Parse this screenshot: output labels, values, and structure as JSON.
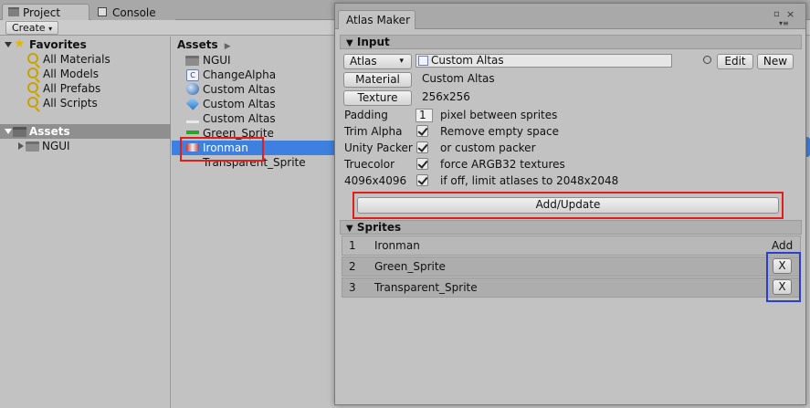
{
  "project_window": {
    "tabs": [
      {
        "label": "Project",
        "active": true
      },
      {
        "label": "Console",
        "active": false
      }
    ],
    "create_label": "Create",
    "favorites": {
      "title": "Favorites",
      "items": [
        "All Materials",
        "All Models",
        "All Prefabs",
        "All Scripts"
      ]
    },
    "assets_root": {
      "title": "Assets",
      "children": [
        "NGUI"
      ]
    },
    "breadcrumb": "Assets",
    "asset_list": [
      {
        "name": "NGUI",
        "icon": "folder-icon"
      },
      {
        "name": "ChangeAlpha",
        "icon": "script-icon"
      },
      {
        "name": "Custom Altas",
        "icon": "material-icon"
      },
      {
        "name": "Custom Altas",
        "icon": "prefab-icon"
      },
      {
        "name": "Custom Altas",
        "icon": "texture-icon"
      },
      {
        "name": "Green_Sprite",
        "icon": "texture-icon"
      },
      {
        "name": "Ironman",
        "icon": "texture-icon",
        "selected": true
      },
      {
        "name": "Transparent_Sprite",
        "icon": "texture-icon"
      }
    ]
  },
  "atlas_maker": {
    "title": "Atlas Maker",
    "input_section": "Input",
    "atlas_dropdown": "Atlas",
    "atlas_field": "Custom Altas",
    "edit_label": "Edit",
    "new_label": "New",
    "material_label": "Material",
    "material_value": "Custom Altas",
    "texture_label": "Texture",
    "texture_value": "256x256",
    "padding_label": "Padding",
    "padding_value": "1",
    "padding_desc": "pixel between sprites",
    "options": [
      {
        "label": "Trim Alpha",
        "checked": true,
        "desc": "Remove empty space"
      },
      {
        "label": "Unity Packer",
        "checked": true,
        "desc": "or custom packer"
      },
      {
        "label": "Truecolor",
        "checked": true,
        "desc": "force ARGB32 textures"
      },
      {
        "label": "4096x4096",
        "checked": true,
        "desc": "if off, limit atlases to 2048x2048"
      }
    ],
    "add_update_label": "Add/Update",
    "sprites_section": "Sprites",
    "sprites": [
      {
        "index": "1",
        "name": "Ironman",
        "action": "Add"
      },
      {
        "index": "2",
        "name": "Green_Sprite",
        "action": "X"
      },
      {
        "index": "3",
        "name": "Transparent_Sprite",
        "action": "X"
      }
    ]
  },
  "colors": {
    "selection_blue": "#3d80df",
    "highlight_red": "#e01e1e",
    "highlight_blue": "#2a3fd0"
  }
}
